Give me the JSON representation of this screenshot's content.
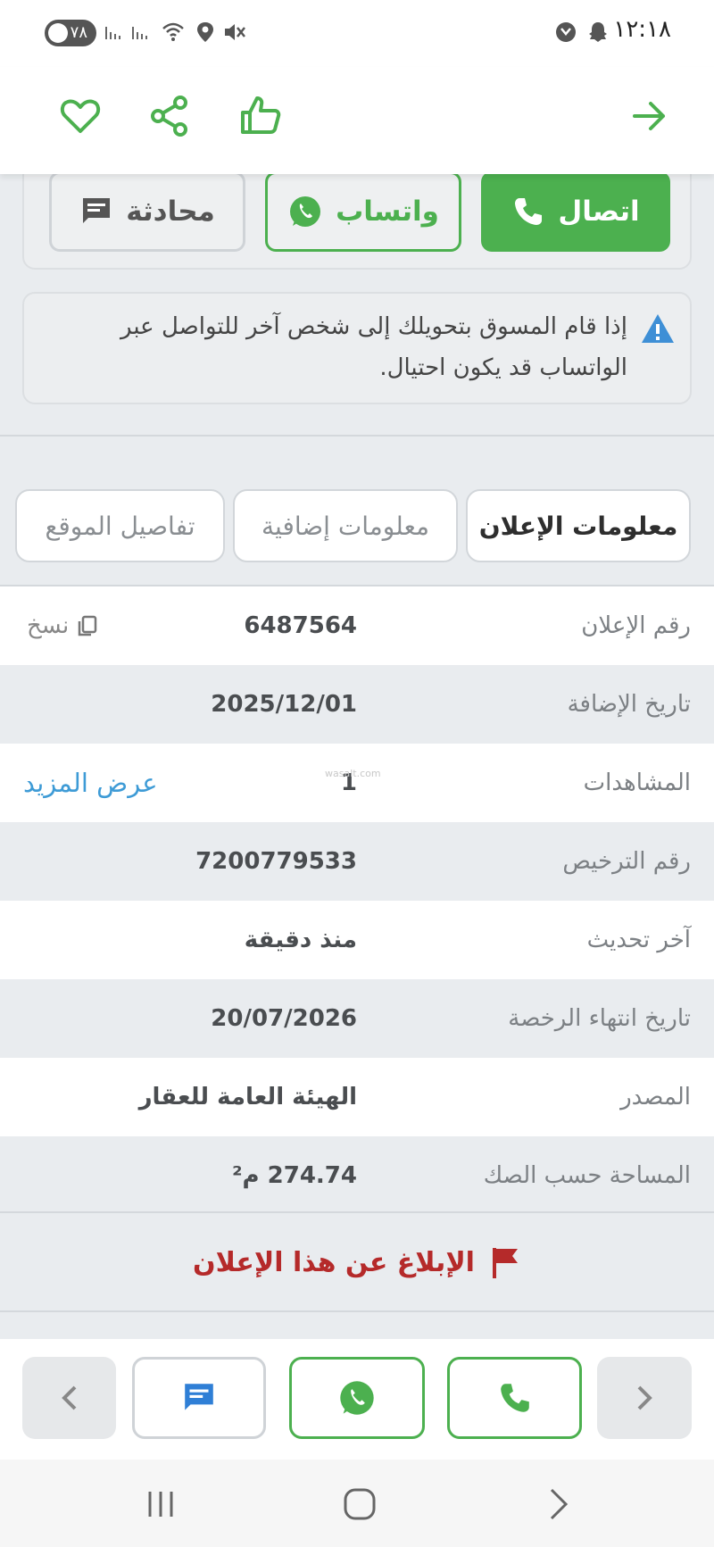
{
  "status_bar": {
    "time": "١٢:١٨",
    "battery": "٧٨"
  },
  "contact": {
    "call_label": "اتصال",
    "whatsapp_label": "واتساب",
    "chat_label": "محادثة"
  },
  "warning_text": "إذا قام المسوق بتحويلك إلى شخص آخر للتواصل عبر الواتساب قد يكون احتيال.",
  "tabs": [
    {
      "label": "معلومات الإعلان",
      "active": true
    },
    {
      "label": "معلومات إضافية",
      "active": false
    },
    {
      "label": "تفاصيل الموقع",
      "active": false
    }
  ],
  "info_rows": [
    {
      "label": "رقم الإعلان",
      "value": "6487564",
      "extra": "نسخ"
    },
    {
      "label": "تاريخ الإضافة",
      "value": "2025/12/01"
    },
    {
      "label": "المشاهدات",
      "value": "1",
      "extra": "عرض المزيد"
    },
    {
      "label": "رقم الترخيص",
      "value": "7200779533"
    },
    {
      "label": "آخر تحديث",
      "value": "منذ دقيقة"
    },
    {
      "label": "تاريخ انتهاء الرخصة",
      "value": "20/07/2026"
    },
    {
      "label": "المصدر",
      "value": "الهيئة العامة للعقار"
    },
    {
      "label": "المساحة حسب الصك",
      "value": "274.74 م²"
    }
  ],
  "report_label": "الإبلاغ عن هذا الإعلان",
  "watermark": "wasalt.com",
  "colors": {
    "accent_green": "#4cb04f",
    "report_red": "#b52a2a",
    "link_blue": "#3e9bd6"
  }
}
